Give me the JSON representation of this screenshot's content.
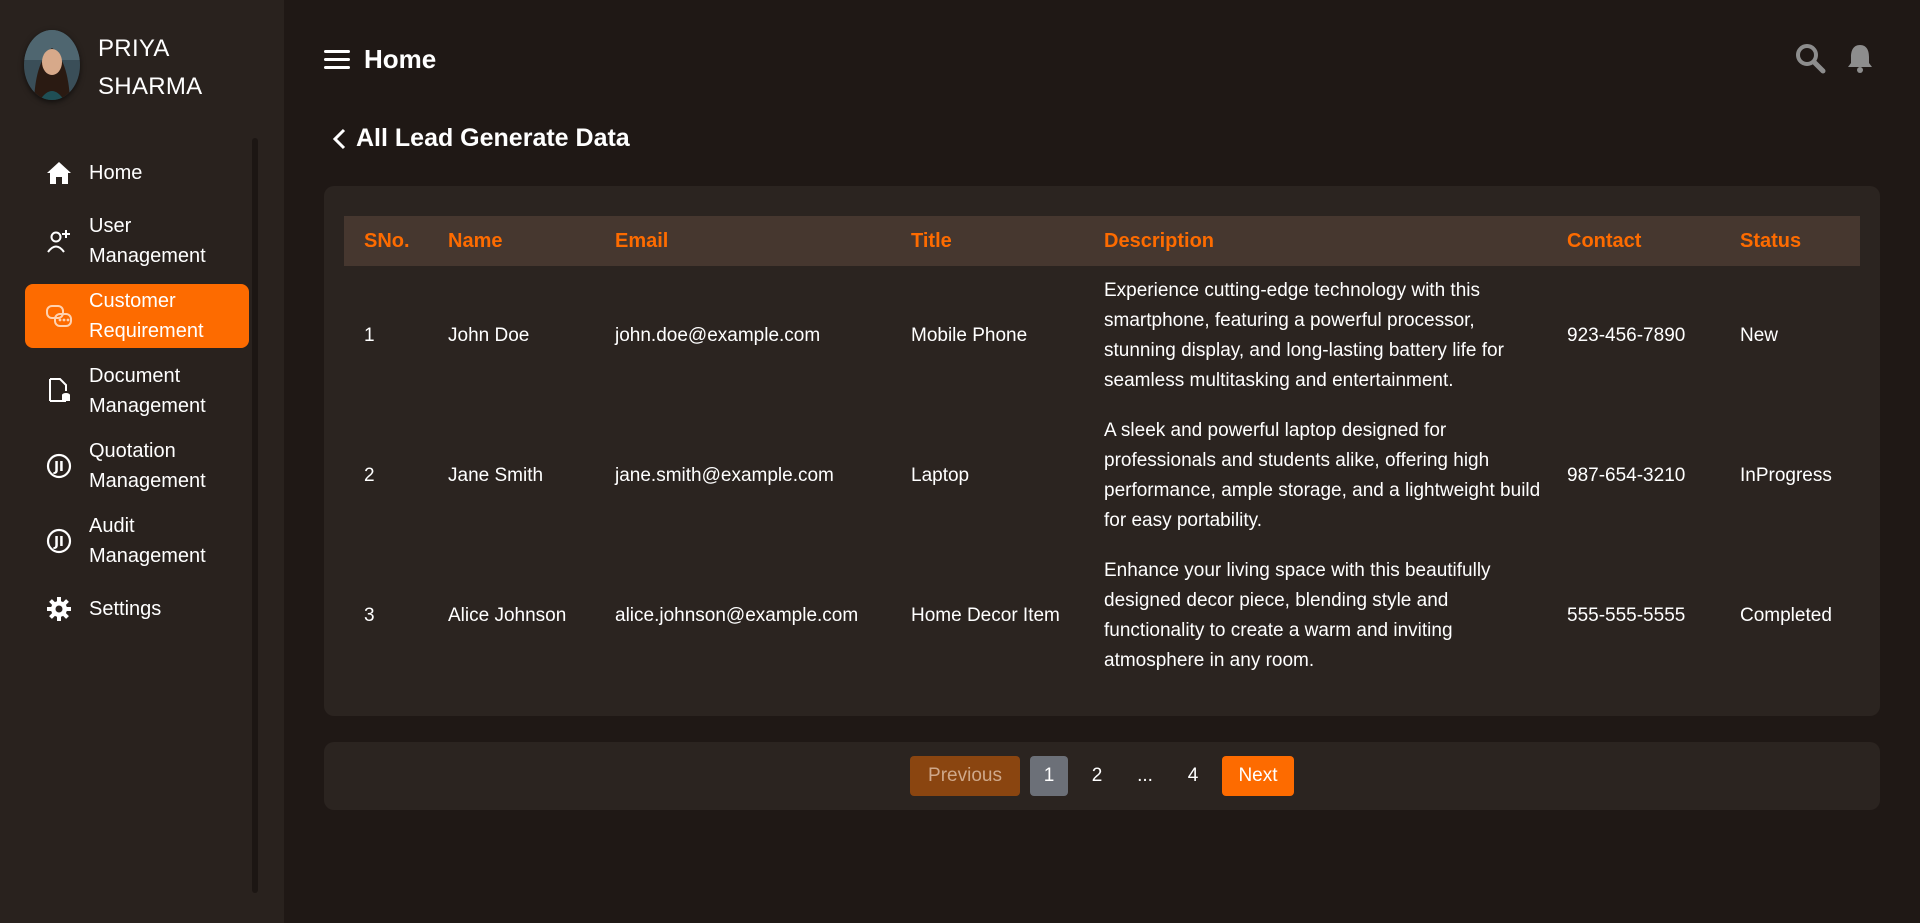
{
  "user": {
    "name": "PRIYA SHARMA"
  },
  "sidebar": {
    "items": [
      {
        "label": "Home",
        "icon": "home-icon",
        "active": false
      },
      {
        "label": "User Management",
        "icon": "user-add-icon",
        "active": false
      },
      {
        "label": "Customer Requirement",
        "icon": "chat-bubbles-icon",
        "active": true
      },
      {
        "label": "Document Management",
        "icon": "document-icon",
        "active": false
      },
      {
        "label": "Quotation Management",
        "icon": "quotation-icon",
        "active": false
      },
      {
        "label": "Audit Management",
        "icon": "audit-icon",
        "active": false
      },
      {
        "label": "Settings",
        "icon": "gear-icon",
        "active": false
      }
    ]
  },
  "header": {
    "title": "Home"
  },
  "page": {
    "back_title": "All Lead Generate Data"
  },
  "table": {
    "columns": [
      "SNo.",
      "Name",
      "Email",
      "Title",
      "Description",
      "Contact",
      "Status"
    ],
    "rows": [
      {
        "sno": "1",
        "name": "John Doe",
        "email": "john.doe@example.com",
        "title": "Mobile Phone",
        "description": "Experience cutting-edge technology with this smartphone, featuring a powerful processor, stunning display, and long-lasting battery life for seamless multitasking and entertainment.",
        "contact": "923-456-7890",
        "status": "New"
      },
      {
        "sno": "2",
        "name": "Jane Smith",
        "email": "jane.smith@example.com",
        "title": "Laptop",
        "description": "A sleek and powerful laptop designed for professionals and students alike, offering high performance, ample storage, and a lightweight build for easy portability.",
        "contact": "987-654-3210",
        "status": "InProgress"
      },
      {
        "sno": "3",
        "name": "Alice Johnson",
        "email": "alice.johnson@example.com",
        "title": "Home Decor Item",
        "description": "Enhance your living space with this beautifully designed decor piece, blending style and functionality to create a warm and inviting atmosphere in any room.",
        "contact": "555-555-5555",
        "status": "Completed"
      }
    ]
  },
  "pagination": {
    "previous_label": "Previous",
    "pages": [
      "1",
      "2",
      "...",
      "4"
    ],
    "current": "1",
    "next_label": "Next"
  },
  "colors": {
    "accent": "#fd6b00",
    "background": "#1f1815",
    "sidebar": "#29221e",
    "card": "#2b2420",
    "table_header": "#46372f"
  }
}
